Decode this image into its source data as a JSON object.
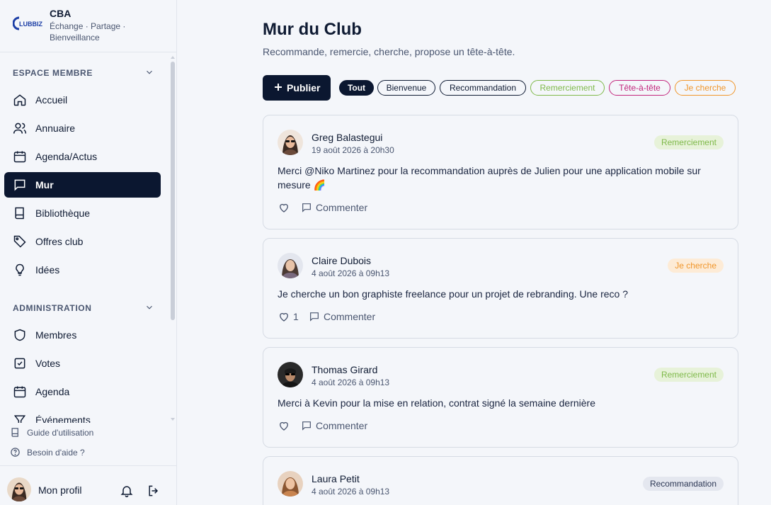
{
  "club": {
    "name": "CBA",
    "tagline": "Échange · Partage · Bienveillance",
    "logo_text": "CLUBBIZ"
  },
  "sidebar": {
    "member_section": "ESPACE MEMBRE",
    "member_items": [
      {
        "label": "Accueil",
        "icon": "home-icon"
      },
      {
        "label": "Annuaire",
        "icon": "users-icon"
      },
      {
        "label": "Agenda/Actus",
        "icon": "calendar-icon"
      },
      {
        "label": "Mur",
        "icon": "message-square-icon",
        "active": true
      },
      {
        "label": "Bibliothèque",
        "icon": "book-icon"
      },
      {
        "label": "Offres club",
        "icon": "tag-icon"
      },
      {
        "label": "Idées",
        "icon": "lightbulb-icon"
      }
    ],
    "admin_section": "ADMINISTRATION",
    "admin_items": [
      {
        "label": "Membres",
        "icon": "shield-icon"
      },
      {
        "label": "Votes",
        "icon": "checkbox-icon"
      },
      {
        "label": "Agenda",
        "icon": "calendar-icon"
      },
      {
        "label": "Événements",
        "icon": "filter-icon"
      }
    ],
    "guide": "Guide d'utilisation",
    "help": "Besoin d'aide ?",
    "profile": "Mon profil"
  },
  "main": {
    "title": "Mur du Club",
    "subtitle": "Recommande, remercie, cherche, propose un tête-à-tête.",
    "publish_label": "Publier",
    "filters": [
      {
        "label": "Tout",
        "color": "#0b1730",
        "active": true
      },
      {
        "label": "Bienvenue",
        "color": "#0f1b33"
      },
      {
        "label": "Recommandation",
        "color": "#0f1b33"
      },
      {
        "label": "Remerciement",
        "color": "#7fb94a"
      },
      {
        "label": "Tête-à-tête",
        "color": "#c2267c"
      },
      {
        "label": "Je cherche",
        "color": "#f0962b"
      }
    ],
    "comment_label": "Commenter",
    "posts": [
      {
        "author": "Greg Balastegui",
        "date": "19 août 2026 à 20h30",
        "category": "Remerciement",
        "text": "Merci @Niko Martinez pour la recommandation auprès de Julien pour une application mobile sur mesure 🌈",
        "likes": ""
      },
      {
        "author": "Claire Dubois",
        "date": "4 août 2026 à 09h13",
        "category": "Je cherche",
        "text": "Je cherche un bon graphiste freelance pour un projet de rebranding. Une reco ?",
        "likes": "1"
      },
      {
        "author": "Thomas Girard",
        "date": "4 août 2026 à 09h13",
        "category": "Remerciement",
        "text": "Merci à Kevin pour la mise en relation, contrat signé la semaine dernière",
        "likes": ""
      },
      {
        "author": "Laura Petit",
        "date": "4 août 2026 à 09h13",
        "category": "Recommandation",
        "text": "",
        "likes": ""
      }
    ]
  },
  "colors": {
    "primary": "#0b1730",
    "background": "#f4f6fa",
    "border": "#d6dbe4",
    "muted": "#4a5670"
  }
}
